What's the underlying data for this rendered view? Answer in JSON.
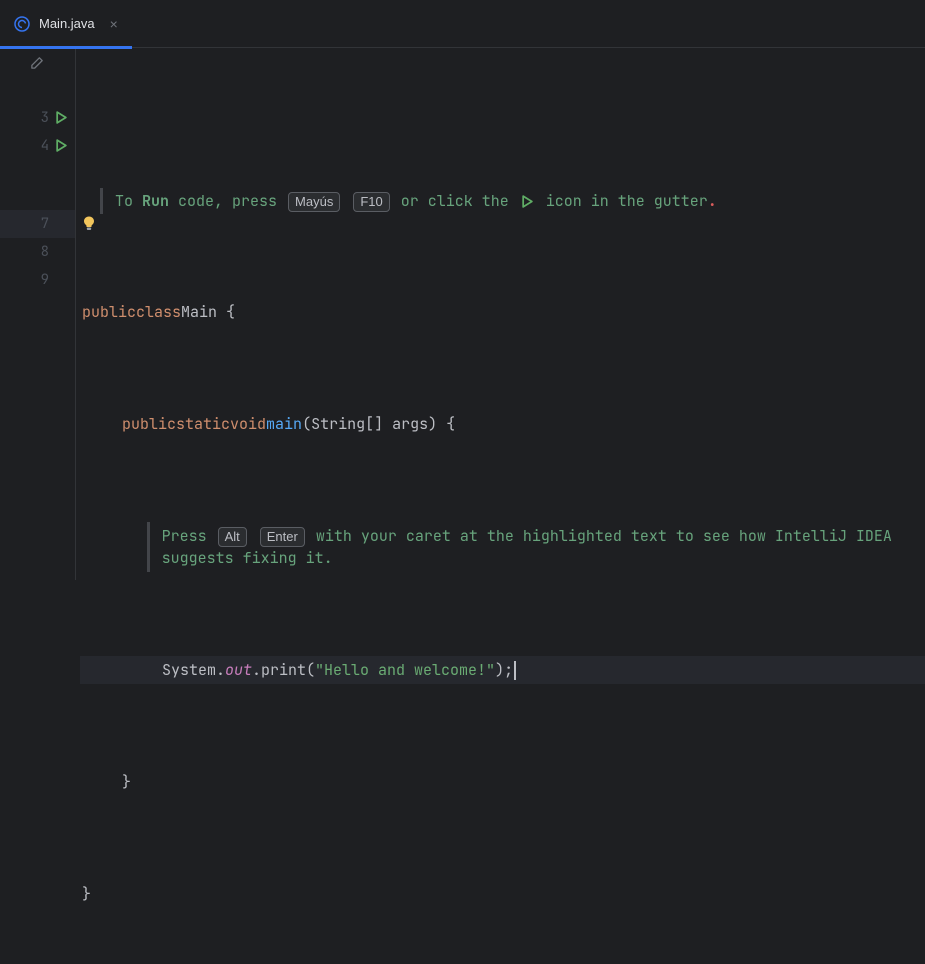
{
  "tab": {
    "label": "Main.java"
  },
  "tip1": {
    "pre": "To ",
    "runWord": "Run",
    "post1": " code, press ",
    "key1": "Mayús",
    "key2": "F10",
    "post2": " or click the ",
    "post3": " icon in the gutter"
  },
  "tip2": {
    "pre": "Press ",
    "key1": "Alt",
    "key2": "Enter",
    "post": " with your caret at the highlighted text to see how IntelliJ IDEA suggests fixing it."
  },
  "lines": {
    "l3": "3",
    "l4": "4",
    "l7": "7",
    "l8": "8",
    "l9": "9"
  },
  "code": {
    "kw_public": "public",
    "kw_class": "class",
    "className": "Main",
    "kw_static": "static",
    "kw_void": "void",
    "methodName": "main",
    "params": "(String[] args)",
    "brace_open": " {",
    "brace_close": "}",
    "sys": "System.",
    "out": "out",
    "print": ".print(",
    "string": "\"Hello and welcome!\"",
    "end": ");"
  }
}
